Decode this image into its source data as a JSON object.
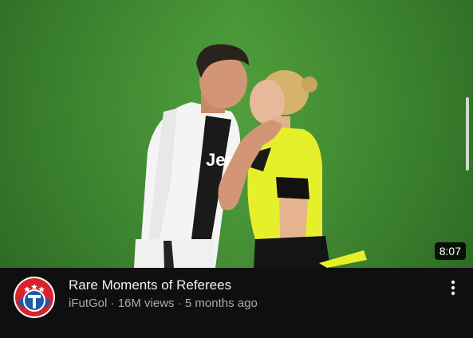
{
  "video": {
    "title": "Rare Moments of Referees",
    "channel": "iFutGol",
    "views": "16M views",
    "age": "5 months ago",
    "separator": " · ",
    "duration": "8:07",
    "jersey_text": "Jeep"
  },
  "icons": {
    "avatar": "ifutgol-logo",
    "more": "more-vert-icon"
  },
  "colors": {
    "background": "#0f0f0f",
    "title": "#f1f1f1",
    "meta": "#aaaaaa",
    "pitch": "#3f8a31",
    "referee_shirt": "#e6f02a"
  }
}
